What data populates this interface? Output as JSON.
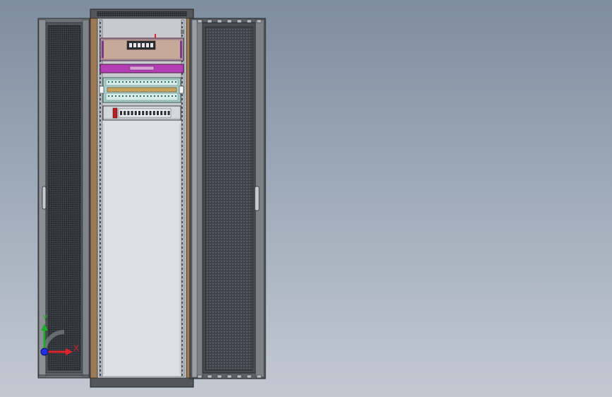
{
  "scene": {
    "background_top": "#7e8d9f",
    "background_bottom": "#c3c9d1",
    "cabinet_frame_color": "#4a4d52",
    "side_rail_color": "#9c7a55",
    "perforation_color": "#2d3136"
  },
  "equipment": [
    {
      "name": "patch-panel",
      "color": "#b08fa6"
    },
    {
      "name": "purple-shelf",
      "color": "#b43fb4"
    },
    {
      "name": "terminal-block-panel",
      "color": "#a8cdca"
    },
    {
      "name": "power-distribution-unit",
      "color": "#d4d8dd"
    }
  ],
  "triad": {
    "x_label": "X",
    "y_label": "Y",
    "x_color": "#e0202a",
    "y_color": "#1faa2a",
    "z_color": "#2030e0"
  }
}
